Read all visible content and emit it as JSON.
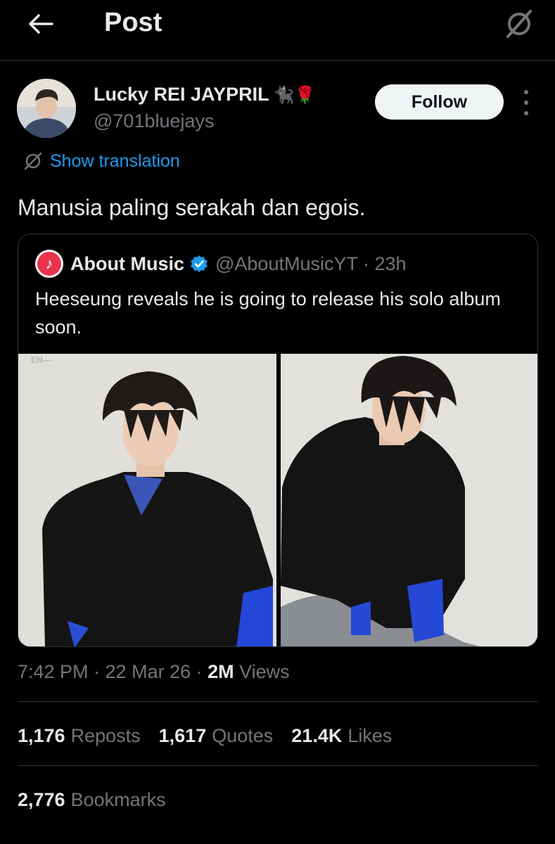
{
  "header": {
    "title": "Post",
    "back_icon": "arrow-left-icon",
    "grok_icon": "grok-icon"
  },
  "author": {
    "name": "Lucky REI JAYPRIL",
    "name_emoji": "🐈‍⬛🌹",
    "handle": "@701bluejays",
    "follow_label": "Follow"
  },
  "translation": {
    "label": "Show translation"
  },
  "post": {
    "text": "Manusia paling serakah dan egois."
  },
  "quote": {
    "name": "About Music",
    "handle_time": "@AboutMusicYT · 23h",
    "text": "Heeseung reveals he is going to release his solo album soon.",
    "watermark": "EN—"
  },
  "meta": {
    "time_date": "7:42 PM · 22 Mar 26 · ",
    "views_count": "2M",
    "views_label": " Views"
  },
  "stats": [
    {
      "count": "1,176",
      "label": "Reposts"
    },
    {
      "count": "1,617",
      "label": "Quotes"
    },
    {
      "count": "21.4K",
      "label": "Likes"
    }
  ],
  "bookmarks": {
    "count": "2,776",
    "label": "Bookmarks"
  },
  "colors": {
    "background": "#000000",
    "accent": "#1d9bf0",
    "secondary_text": "#71767b",
    "divider": "#2f3336"
  }
}
